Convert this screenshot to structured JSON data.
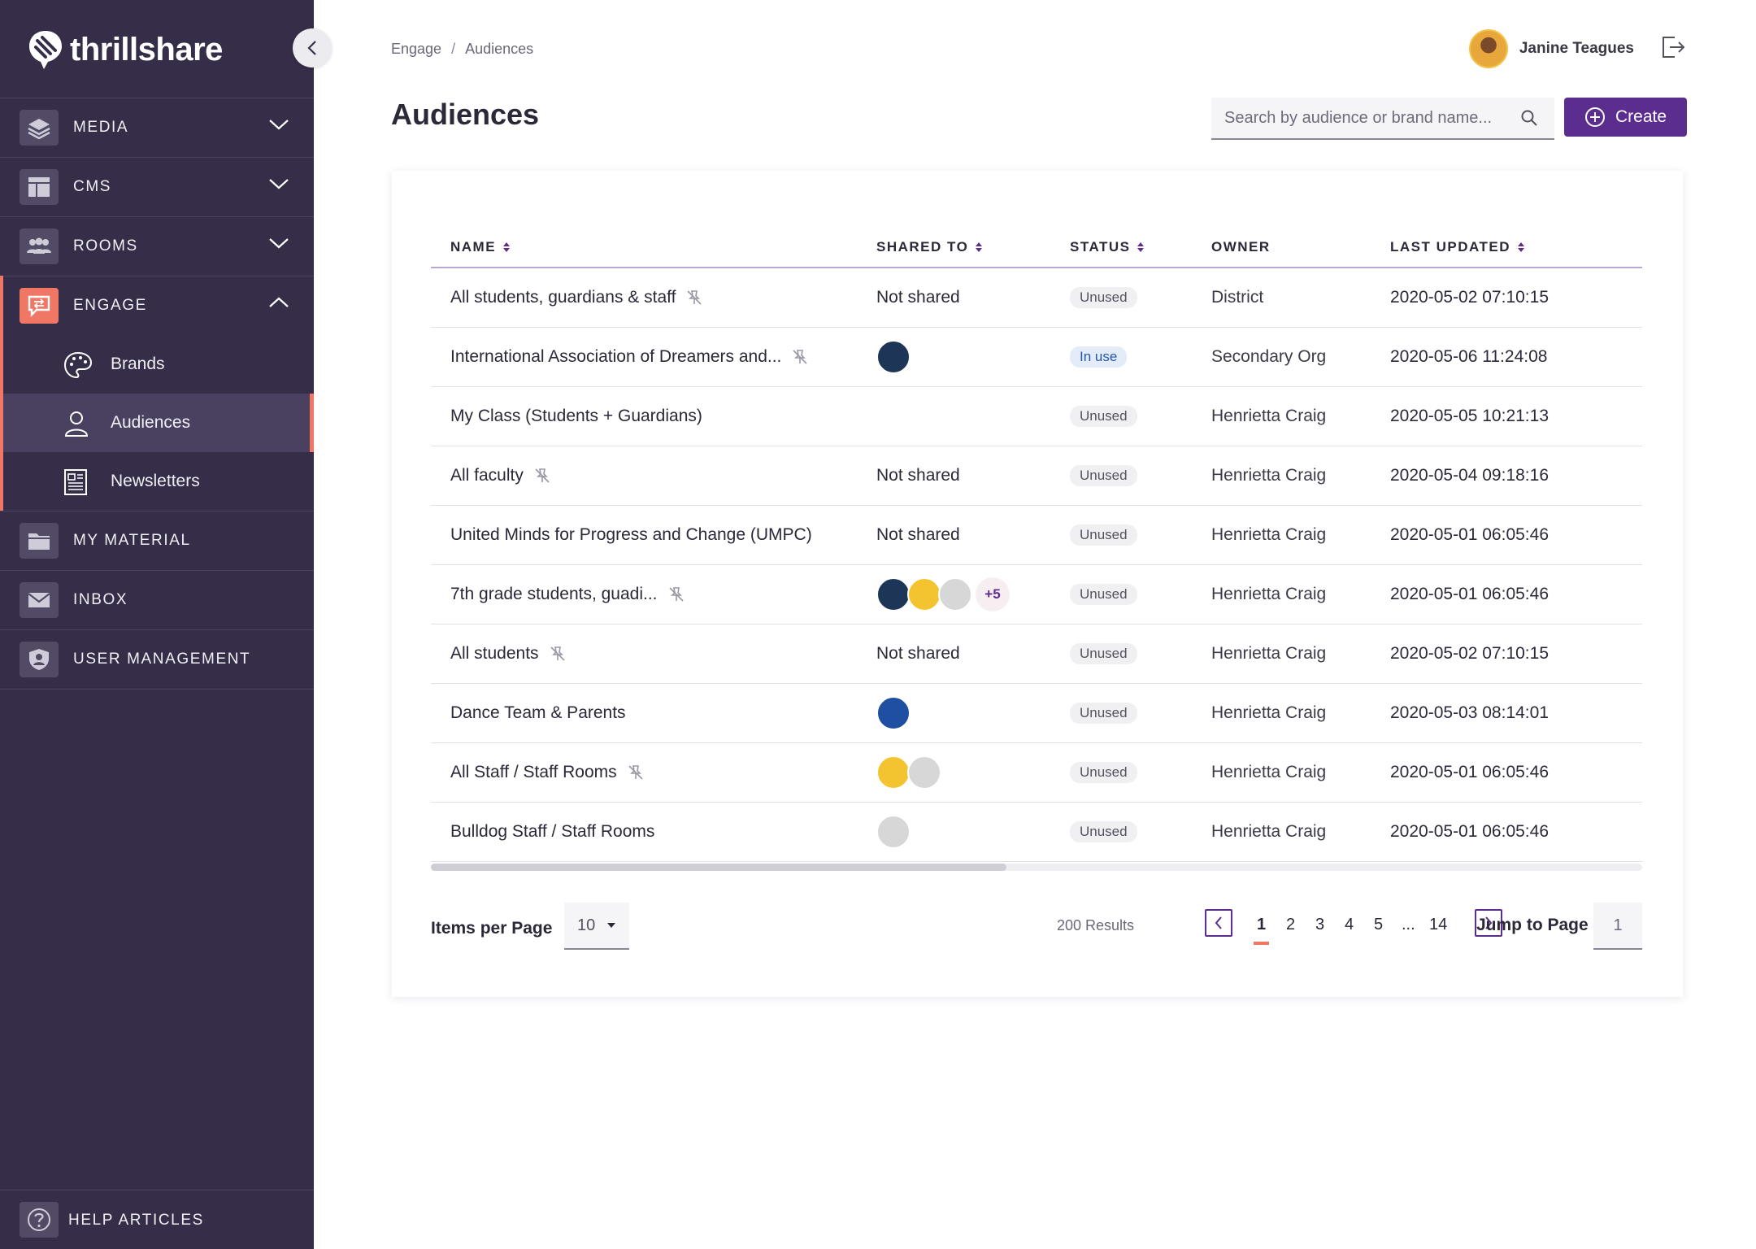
{
  "app": {
    "name": "thrillshare"
  },
  "sidebar": {
    "items": [
      {
        "label": "MEDIA"
      },
      {
        "label": "CMS"
      },
      {
        "label": "ROOMS"
      },
      {
        "label": "ENGAGE"
      },
      {
        "label": "MY MATERIAL"
      },
      {
        "label": "INBOX"
      },
      {
        "label": "USER MANAGEMENT"
      }
    ],
    "engage_sub": [
      {
        "label": "Brands"
      },
      {
        "label": "Audiences"
      },
      {
        "label": "Newsletters"
      }
    ],
    "help_label": "HELP ARTICLES"
  },
  "breadcrumb": {
    "parent": "Engage",
    "current": "Audiences",
    "separator": "/"
  },
  "user": {
    "name": "Janine Teagues"
  },
  "page": {
    "title": "Audiences"
  },
  "search": {
    "placeholder": "Search by audience or brand name..."
  },
  "create_label": "Create",
  "table": {
    "columns": {
      "name": "NAME",
      "shared": "SHARED TO",
      "status": "STATUS",
      "owner": "OWNER",
      "updated": "LAST UPDATED"
    },
    "rows": [
      {
        "name": "All students, guardians & staff",
        "shared": "Not shared",
        "status": "Unused",
        "owner": "District",
        "updated": "2020-05-02 07:10:15"
      },
      {
        "name": "International Association of Dreamers and...",
        "shared": "",
        "status": "In use",
        "owner": "Secondary Org",
        "updated": "2020-05-06 11:24:08"
      },
      {
        "name": "My Class (Students + Guardians)",
        "shared": "",
        "status": "Unused",
        "owner": "Henrietta Craig",
        "updated": "2020-05-05 10:21:13"
      },
      {
        "name": "All faculty",
        "shared": "Not shared",
        "status": "Unused",
        "owner": "Henrietta Craig",
        "updated": "2020-05-04 09:18:16"
      },
      {
        "name": "United Minds for Progress and Change (UMPC)",
        "shared": "Not shared",
        "status": "Unused",
        "owner": "Henrietta Craig",
        "updated": "2020-05-01 06:05:46"
      },
      {
        "name": "7th grade students, guadi...",
        "shared": "",
        "shared_more": "+5",
        "status": "Unused",
        "owner": "Henrietta Craig",
        "updated": "2020-05-01 06:05:46"
      },
      {
        "name": "All students",
        "shared": "Not shared",
        "status": "Unused",
        "owner": "Henrietta Craig",
        "updated": "2020-05-02 07:10:15"
      },
      {
        "name": "Dance Team & Parents",
        "shared": "",
        "status": "Unused",
        "owner": "Henrietta Craig",
        "updated": "2020-05-03 08:14:01"
      },
      {
        "name": "All Staff / Staff Rooms",
        "shared": "",
        "status": "Unused",
        "owner": "Henrietta Craig",
        "updated": "2020-05-01 06:05:46"
      },
      {
        "name": "Bulldog Staff / Staff Rooms",
        "shared": "",
        "status": "Unused",
        "owner": "Henrietta Craig",
        "updated": "2020-05-01 06:05:46"
      }
    ]
  },
  "pagination": {
    "items_per_page_label": "Items per Page",
    "items_per_page": "10",
    "results": "200 Results",
    "pages": [
      "1",
      "2",
      "3",
      "4",
      "5",
      "...",
      "14"
    ],
    "current_page": "1",
    "jump_label": "Jump to Page",
    "jump_value": "1"
  },
  "colors": {
    "sidebar_bg": "#362d48",
    "accent": "#5b2d8e",
    "highlight": "#f07766"
  }
}
